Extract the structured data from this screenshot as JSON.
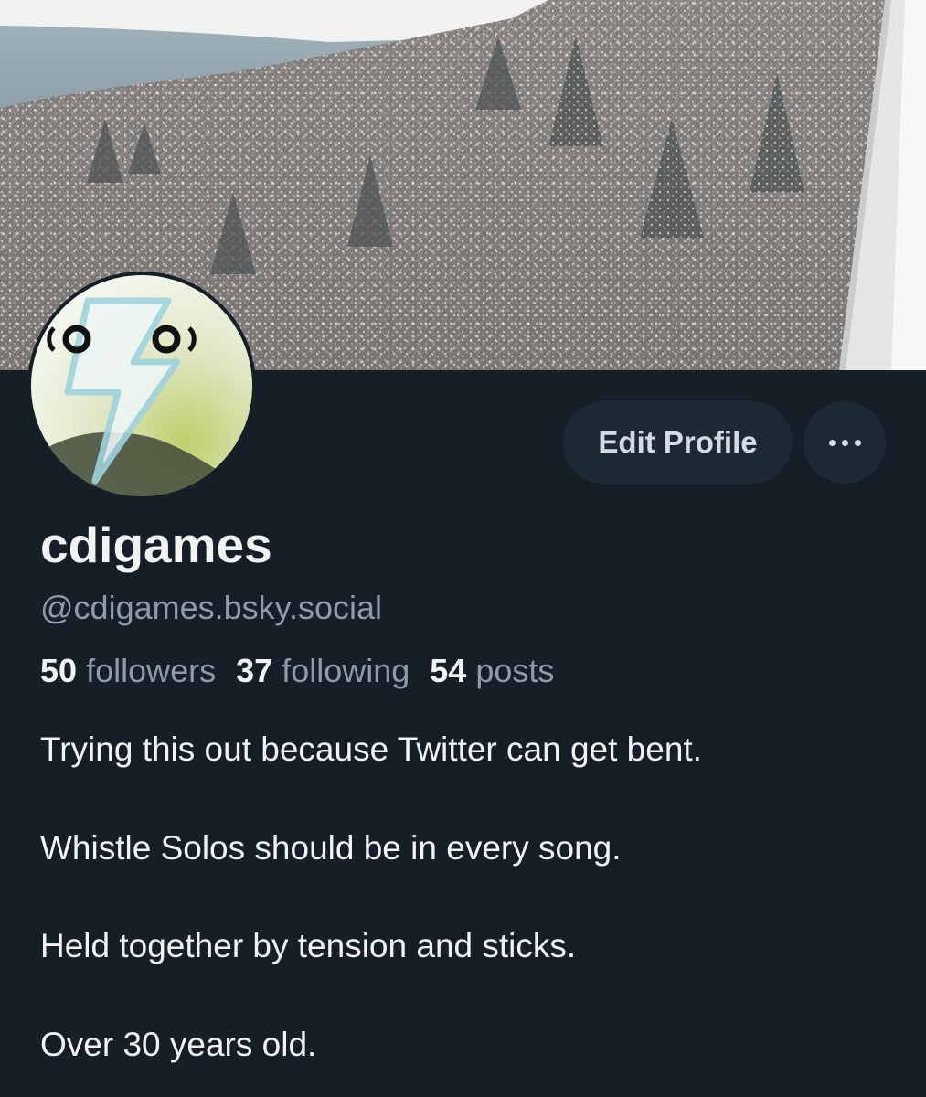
{
  "profile": {
    "display_name": "cdigames",
    "handle": "@cdigames.bsky.social"
  },
  "actions": {
    "edit_label": "Edit Profile",
    "more_icon": "ellipsis-icon"
  },
  "stats": {
    "followers_count": "50",
    "followers_label": "followers",
    "following_count": "37",
    "following_label": "following",
    "posts_count": "54",
    "posts_label": "posts"
  },
  "bio": {
    "lines": [
      "Trying this out because Twitter can get bent.",
      "Whistle Solos should be in every song.",
      "Held together by tension and sticks.",
      "Over 30 years old."
    ]
  },
  "colors": {
    "background": "#161e27",
    "button_bg": "#1e2936",
    "muted_text": "#8e9bab",
    "primary_text": "#f1f3f5"
  }
}
